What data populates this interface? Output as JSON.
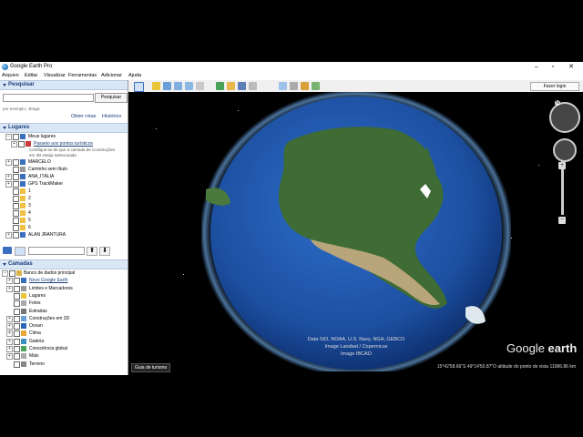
{
  "window": {
    "title": "Google Earth Pro",
    "controls": [
      "–",
      "▫",
      "✕"
    ]
  },
  "menu": [
    "Arquivo",
    "Editar",
    "Visualizar",
    "Ferramentas",
    "Adicionar",
    "Ajuda"
  ],
  "toolbar": {
    "login_label": "Fazer login",
    "icons": [
      "sidebar-toggle-icon",
      "placemark-icon",
      "polygon-icon",
      "path-icon",
      "image-overlay-icon",
      "record-tour-icon",
      "historical-imagery-icon",
      "sun-icon",
      "planet-icon",
      "ruler-icon",
      "email-icon",
      "print-icon",
      "save-image-icon",
      "view-in-maps-icon"
    ]
  },
  "search": {
    "header": "Pesquisar",
    "button": "Pesquisar",
    "hint": "por exemplo,: Braga",
    "links": [
      "Obter rotas",
      "Histórico"
    ]
  },
  "places": {
    "header": "Lugares",
    "items": [
      {
        "label": "Meus lugares",
        "expander": "−",
        "link": false,
        "indent": 0
      },
      {
        "label": "Passeio aos pontos turísticos",
        "expander": "+",
        "link": true,
        "indent": 1
      },
      {
        "label": "MARCELO",
        "expander": "+",
        "link": false,
        "indent": 0
      },
      {
        "label": "Caminho sem título",
        "expander": "",
        "link": false,
        "indent": 0
      },
      {
        "label": "ANA_ITÁLIA",
        "expander": "+",
        "link": false,
        "indent": 0
      },
      {
        "label": "GPS TrackMaker",
        "expander": "+",
        "link": false,
        "indent": 0
      },
      {
        "label": "1",
        "expander": "",
        "link": false,
        "indent": 0
      },
      {
        "label": "2",
        "expander": "",
        "link": false,
        "indent": 0
      },
      {
        "label": "3",
        "expander": "",
        "link": false,
        "indent": 0
      },
      {
        "label": "4",
        "expander": "",
        "link": false,
        "indent": 0
      },
      {
        "label": "5",
        "expander": "",
        "link": false,
        "indent": 0
      },
      {
        "label": "6",
        "expander": "",
        "link": false,
        "indent": 0
      },
      {
        "label": "ALAN JRANTURA",
        "expander": "+",
        "link": false,
        "indent": 0
      }
    ],
    "note": "Certifique-se de que a camada de Construções em 3D esteja selecionada"
  },
  "layers": {
    "header": "Camadas",
    "root": "Banco de dados principal",
    "items": [
      {
        "label": "Novo Google Earth",
        "expander": "+",
        "link": true
      },
      {
        "label": "Limites e Marcadores",
        "expander": "+",
        "link": false
      },
      {
        "label": "Lugares",
        "expander": "",
        "link": false
      },
      {
        "label": "Fotos",
        "expander": "",
        "link": false
      },
      {
        "label": "Estradas",
        "expander": "",
        "link": false
      },
      {
        "label": "Construções em 3D",
        "expander": "+",
        "link": false
      },
      {
        "label": "Ocean",
        "expander": "+",
        "link": false
      },
      {
        "label": "Clima",
        "expander": "+",
        "link": false
      },
      {
        "label": "Galeria",
        "expander": "+",
        "link": false
      },
      {
        "label": "Consciência global",
        "expander": "+",
        "link": false
      },
      {
        "label": "Mais",
        "expander": "+",
        "link": false
      },
      {
        "label": "Terreno",
        "expander": "",
        "link": false
      }
    ]
  },
  "map": {
    "attribution": [
      "Data SIO, NOAA, U.S. Navy, NGA, GEBCO",
      "Image Landsat / Copernicus",
      "Image IBCAO"
    ],
    "logo_light": "Google",
    "logo_bold": " earth",
    "tour_guide": "Guia de turismo",
    "coords": "15°42'58.66\"S  49°14'50.87\"O  altitude do ponto de vista 11086.86 km",
    "colors": {
      "ocean": "#1c4fa0",
      "land": "#3f6b35",
      "desert": "#b9a57a"
    }
  }
}
